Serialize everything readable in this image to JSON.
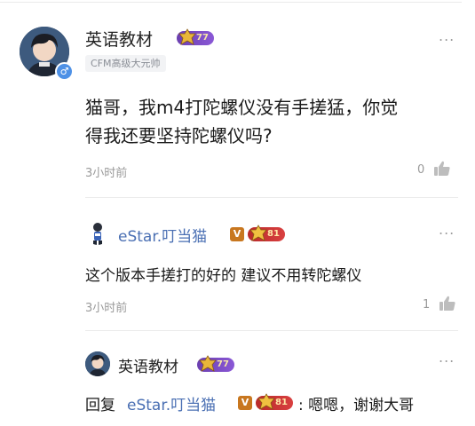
{
  "colors": {
    "name_blue": "#4a6fb3",
    "badge_purple": "#7a4cc8",
    "badge_red": "#c83232",
    "vip_orange": "#c8771f"
  },
  "main_comment": {
    "username": "英语教材",
    "level_badge": "77",
    "user_tag": "CFM高级大元帅",
    "gender_icon": "male-icon",
    "text_line1": "猫哥，我m4打陀螺仪没有手搓猛，你觉",
    "text_line2": "得我还要坚持陀螺仪吗?",
    "time": "3小时前",
    "like_count": "0",
    "more_label": "..."
  },
  "reply1": {
    "username": "eStar.叮当猫",
    "vip_label": "V",
    "level_badge": "81",
    "text": "这个版本手搓打的好的  建议不用转陀螺仪",
    "time": "3小时前",
    "like_count": "1",
    "more_label": "..."
  },
  "reply2": {
    "username": "英语教材",
    "level_badge": "77",
    "reply_prefix": "回复",
    "reply_target": "eStar.叮当猫",
    "vip_label": "V",
    "target_level_badge": "81",
    "text": ": 嗯嗯，谢谢大哥",
    "more_label": "..."
  }
}
